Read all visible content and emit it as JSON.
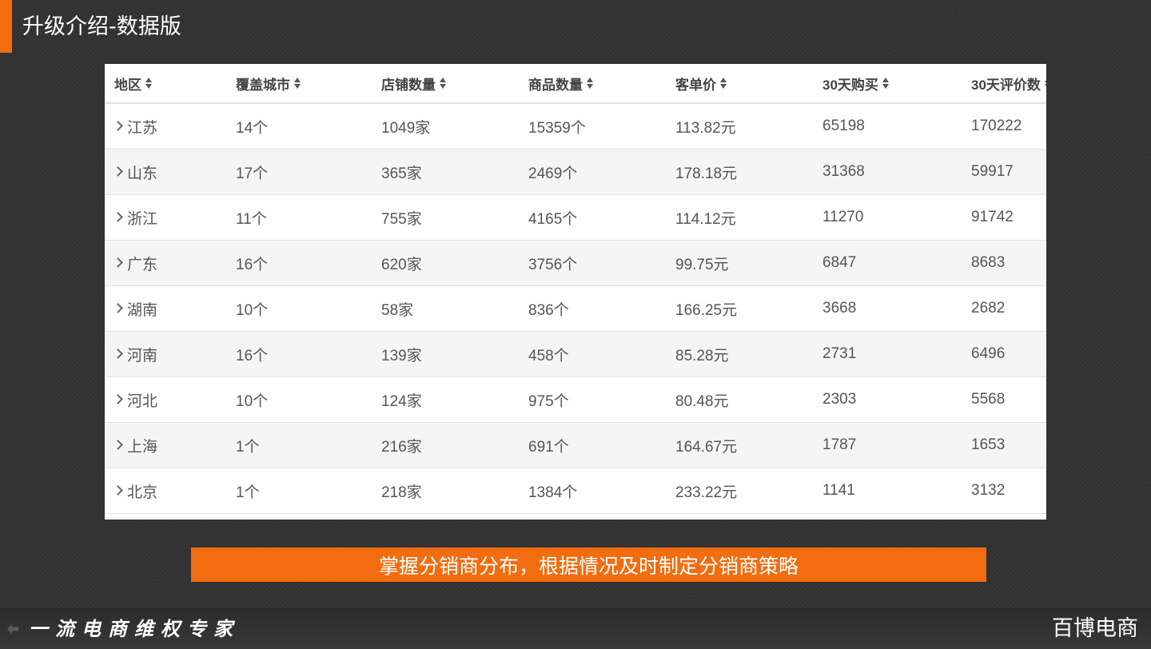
{
  "header": {
    "title": "升级介绍-数据版"
  },
  "colors": {
    "accent": "#f26d0f",
    "background": "#333333",
    "table_bg": "#ffffff",
    "row_alt_bg": "#f5f5f5"
  },
  "table": {
    "columns": [
      "地区",
      "覆盖城市",
      "店铺数量",
      "商品数量",
      "客单价",
      "30天购买",
      "30天评价数"
    ],
    "rows": [
      {
        "region": "江苏",
        "cities": "14个",
        "shops": "1049家",
        "products": "15359个",
        "avg_price": "113.82元",
        "purchases_30d": "65198",
        "reviews_30d": "170222"
      },
      {
        "region": "山东",
        "cities": "17个",
        "shops": "365家",
        "products": "2469个",
        "avg_price": "178.18元",
        "purchases_30d": "31368",
        "reviews_30d": "59917"
      },
      {
        "region": "浙江",
        "cities": "11个",
        "shops": "755家",
        "products": "4165个",
        "avg_price": "114.12元",
        "purchases_30d": "11270",
        "reviews_30d": "91742"
      },
      {
        "region": "广东",
        "cities": "16个",
        "shops": "620家",
        "products": "3756个",
        "avg_price": "99.75元",
        "purchases_30d": "6847",
        "reviews_30d": "8683"
      },
      {
        "region": "湖南",
        "cities": "10个",
        "shops": "58家",
        "products": "836个",
        "avg_price": "166.25元",
        "purchases_30d": "3668",
        "reviews_30d": "2682"
      },
      {
        "region": "河南",
        "cities": "16个",
        "shops": "139家",
        "products": "458个",
        "avg_price": "85.28元",
        "purchases_30d": "2731",
        "reviews_30d": "6496"
      },
      {
        "region": "河北",
        "cities": "10个",
        "shops": "124家",
        "products": "975个",
        "avg_price": "80.48元",
        "purchases_30d": "2303",
        "reviews_30d": "5568"
      },
      {
        "region": "上海",
        "cities": "1个",
        "shops": "216家",
        "products": "691个",
        "avg_price": "164.67元",
        "purchases_30d": "1787",
        "reviews_30d": "1653"
      },
      {
        "region": "北京",
        "cities": "1个",
        "shops": "218家",
        "products": "1384个",
        "avg_price": "233.22元",
        "purchases_30d": "1141",
        "reviews_30d": "3132"
      }
    ]
  },
  "banner": {
    "text": "掌握分销商分布，根据情况及时制定分销商策略"
  },
  "footer": {
    "slogan": "一流电商维权专家",
    "brand": "百博电商",
    "back_icon": "back-arrow-icon"
  }
}
